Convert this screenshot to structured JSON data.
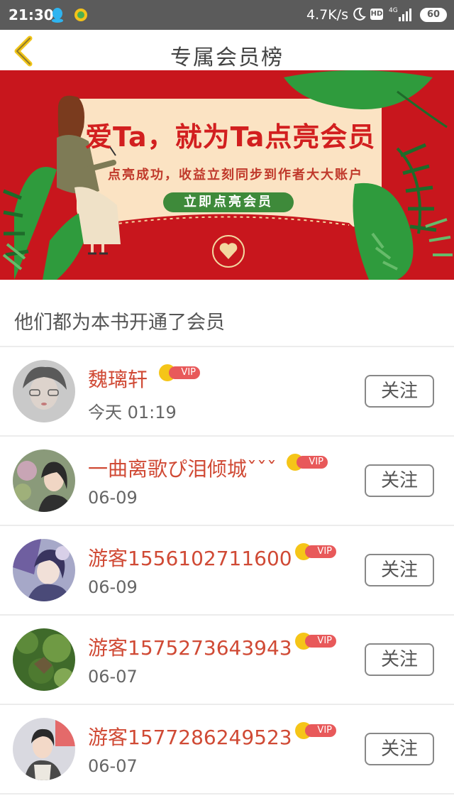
{
  "status_bar": {
    "time": "21:30",
    "net_speed": "4.7K/s",
    "hd": "HD",
    "network": "4G",
    "battery": "60"
  },
  "header": {
    "title": "专属会员榜",
    "back_icon": "chevron-left-icon"
  },
  "banner": {
    "headline": "爱Ta，就为Ta点亮会员",
    "subtitle": "点亮成功，收益立刻同步到作者大大账户",
    "button_label": "立即点亮会员"
  },
  "section": {
    "title": "他们都为本书开通了会员"
  },
  "vip_label": "VIP",
  "follow_label": "关注",
  "members": [
    {
      "name": "魏璃轩",
      "date": "今天 01:19"
    },
    {
      "name": "一曲离歌ぴ泪倾城ˇˇˇ",
      "date": "06-09"
    },
    {
      "name": "游客1556102711600",
      "date": "06-09"
    },
    {
      "name": "游客1575273643943",
      "date": "06-07"
    },
    {
      "name": "游客1577286249523",
      "date": "06-07"
    }
  ],
  "colors": {
    "status_bar": "#5b5b5b",
    "banner_red": "#c8161d",
    "name_red": "#d04a35",
    "vip_tag": "#e8595a",
    "crown": "#f5c518",
    "button_green": "#3e8a3a"
  }
}
